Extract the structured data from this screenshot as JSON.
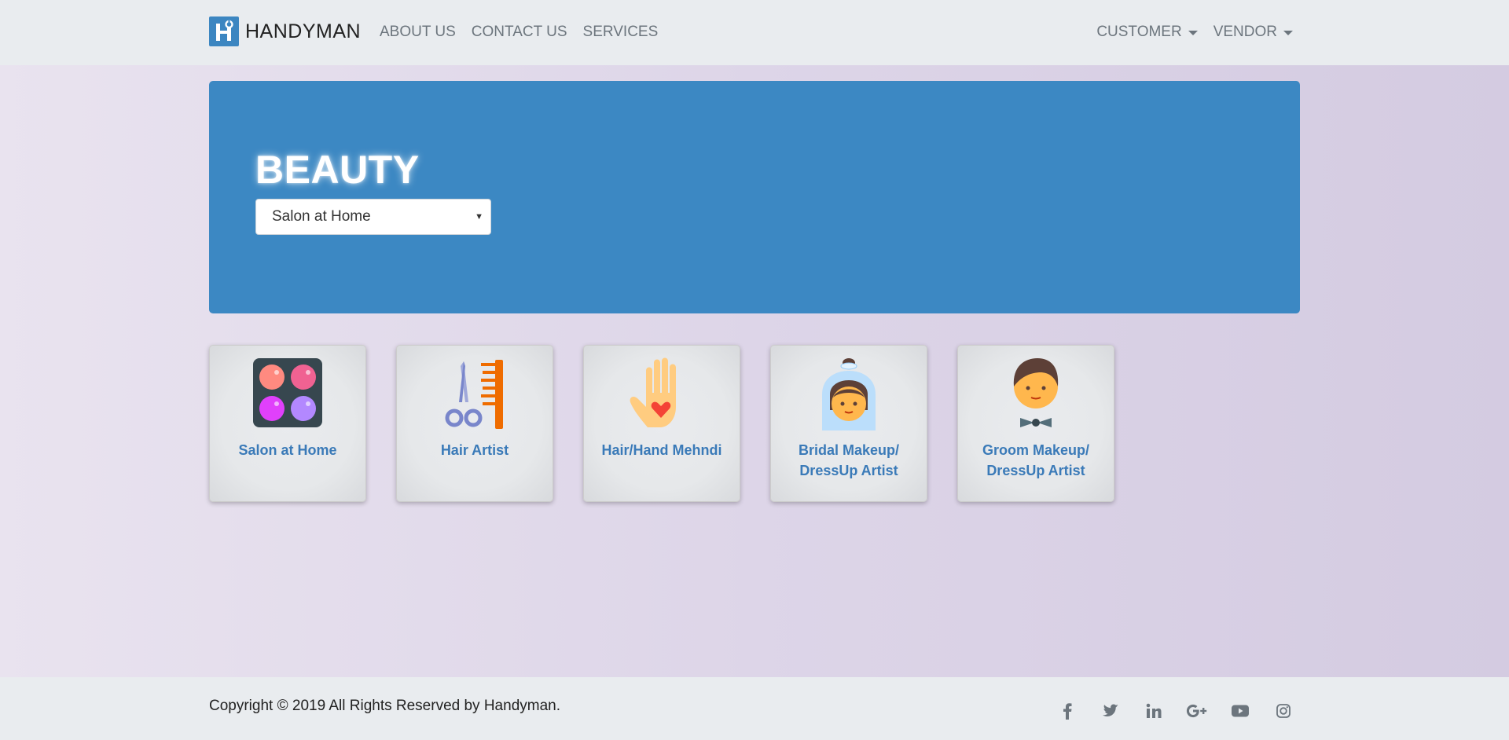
{
  "navbar": {
    "brand": "HANDYMAN",
    "brand_logo_icon": "h-wrench-logo-icon",
    "links": [
      "ABOUT US",
      "CONTACT US",
      "SERVICES"
    ],
    "dropdowns": [
      "CUSTOMER",
      "VENDOR"
    ]
  },
  "jumbotron": {
    "title": "BEAUTY",
    "select_value": "Salon at Home",
    "background": "#3c88c3"
  },
  "services": [
    {
      "label": "Salon at Home",
      "icon": "makeup-palette-icon"
    },
    {
      "label": "Hair Artist",
      "icon": "scissors-comb-icon"
    },
    {
      "label": "Hair/Hand Mehndi",
      "icon": "hand-heart-icon"
    },
    {
      "label": "Bridal Makeup/\nDressUp Artist",
      "icon": "bride-icon"
    },
    {
      "label": "Groom Makeup/\nDressUp Artist",
      "icon": "groom-icon"
    }
  ],
  "footer": {
    "copyright": "Copyright © 2019 All Rights Reserved by Handyman.",
    "social": [
      "facebook-icon",
      "twitter-icon",
      "linkedin-icon",
      "google-plus-icon",
      "youtube-icon",
      "instagram-icon"
    ]
  },
  "colors": {
    "accent": "#3c88c3",
    "card_label": "#3a7ab8",
    "nav_text": "#6c757d"
  }
}
